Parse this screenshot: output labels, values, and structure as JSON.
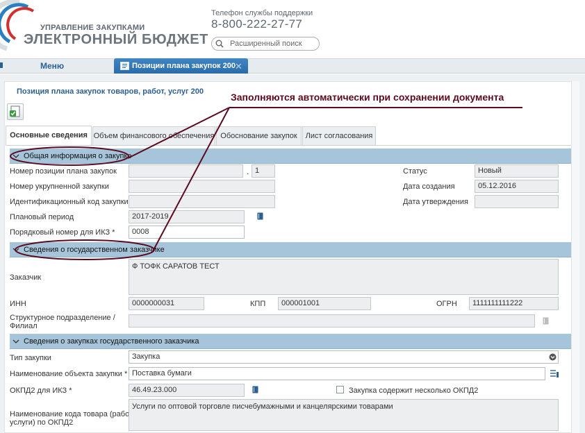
{
  "header": {
    "brand_top": "УПРАВЛЕНИЕ ЗАКУПКАМИ",
    "brand_main": "ЭЛЕКТРОННЫЙ БЮДЖЕТ",
    "support_label": "Телефон службы поддержки",
    "support_phone": "8-800-222-27-77",
    "search_placeholder": "Расширенный поиск"
  },
  "nav": {
    "menu_label": "Меню",
    "active_tab": "Позиции плана закупок 200",
    "close_glyph": "✕"
  },
  "document": {
    "title": "Позиция плана закупок товаров, работ, услуг 200",
    "tabs": [
      {
        "label": "Основные сведения",
        "active": true
      },
      {
        "label": "Объем финансового обеспечения",
        "active": false
      },
      {
        "label": "Обоснование закупок",
        "active": false
      },
      {
        "label": "Лист согласования",
        "active": false
      }
    ]
  },
  "sections": {
    "general": {
      "title": "Общая информация о закупке",
      "plan_position_label": "Номер позиции плана закупок",
      "plan_position_value": "",
      "plan_position_sep": ".",
      "plan_position_suffix": "1",
      "consolidated_label": "Номер укрупненной закупки",
      "consolidated_value": "",
      "ikz_label": "Идентификационный код закупки",
      "ikz_value": "",
      "period_label": "Плановый период",
      "period_value": "2017-2019",
      "ordinal_label": "Порядковый номер для ИКЗ *",
      "ordinal_value": "0008",
      "status_label": "Статус",
      "status_value": "Новый",
      "created_label": "Дата создания",
      "created_value": "05.12.2016",
      "approved_label": "Дата утверждения",
      "approved_value": ""
    },
    "customer": {
      "title": "Сведения о государственном заказчике",
      "customer_label": "Заказчик",
      "customer_value": "Ф ТОФК САРАТОВ ТЕСТ",
      "inn_label": "ИНН",
      "inn_value": "0000000031",
      "kpp_label": "КПП",
      "kpp_value": "000001001",
      "ogrn_label": "ОГРН",
      "ogrn_value": "1111111111222",
      "branch_label_1": "Структурное подразделение /",
      "branch_label_2": "Филиал",
      "branch_value": ""
    },
    "purchases": {
      "title": "Сведения о закупках государственного заказчика",
      "type_label": "Тип закупки",
      "type_value": "Закупка",
      "object_label": "Наименование объекта закупки *",
      "object_value": "Поставка бумаги",
      "okpd_label": "ОКПД2 для ИКЗ *",
      "okpd_value": "46.49.23.000",
      "multi_okpd_label": "Закупка содержит несколько ОКПД2",
      "code_name_label_1": "Наименование кода товара (работы,",
      "code_name_label_2": "услуги) по ОКПД2",
      "code_name_value": "Услуги по оптовой торговле писчебумажными и канцелярскими товарами"
    }
  },
  "annotation": {
    "text": "Заполняются автоматически при сохранении документа",
    "color": "#5c0a1e"
  },
  "colors": {
    "accent": "#2c5f93",
    "section_bg": "#a6c5da",
    "tab_active": "#2a6ca9"
  }
}
